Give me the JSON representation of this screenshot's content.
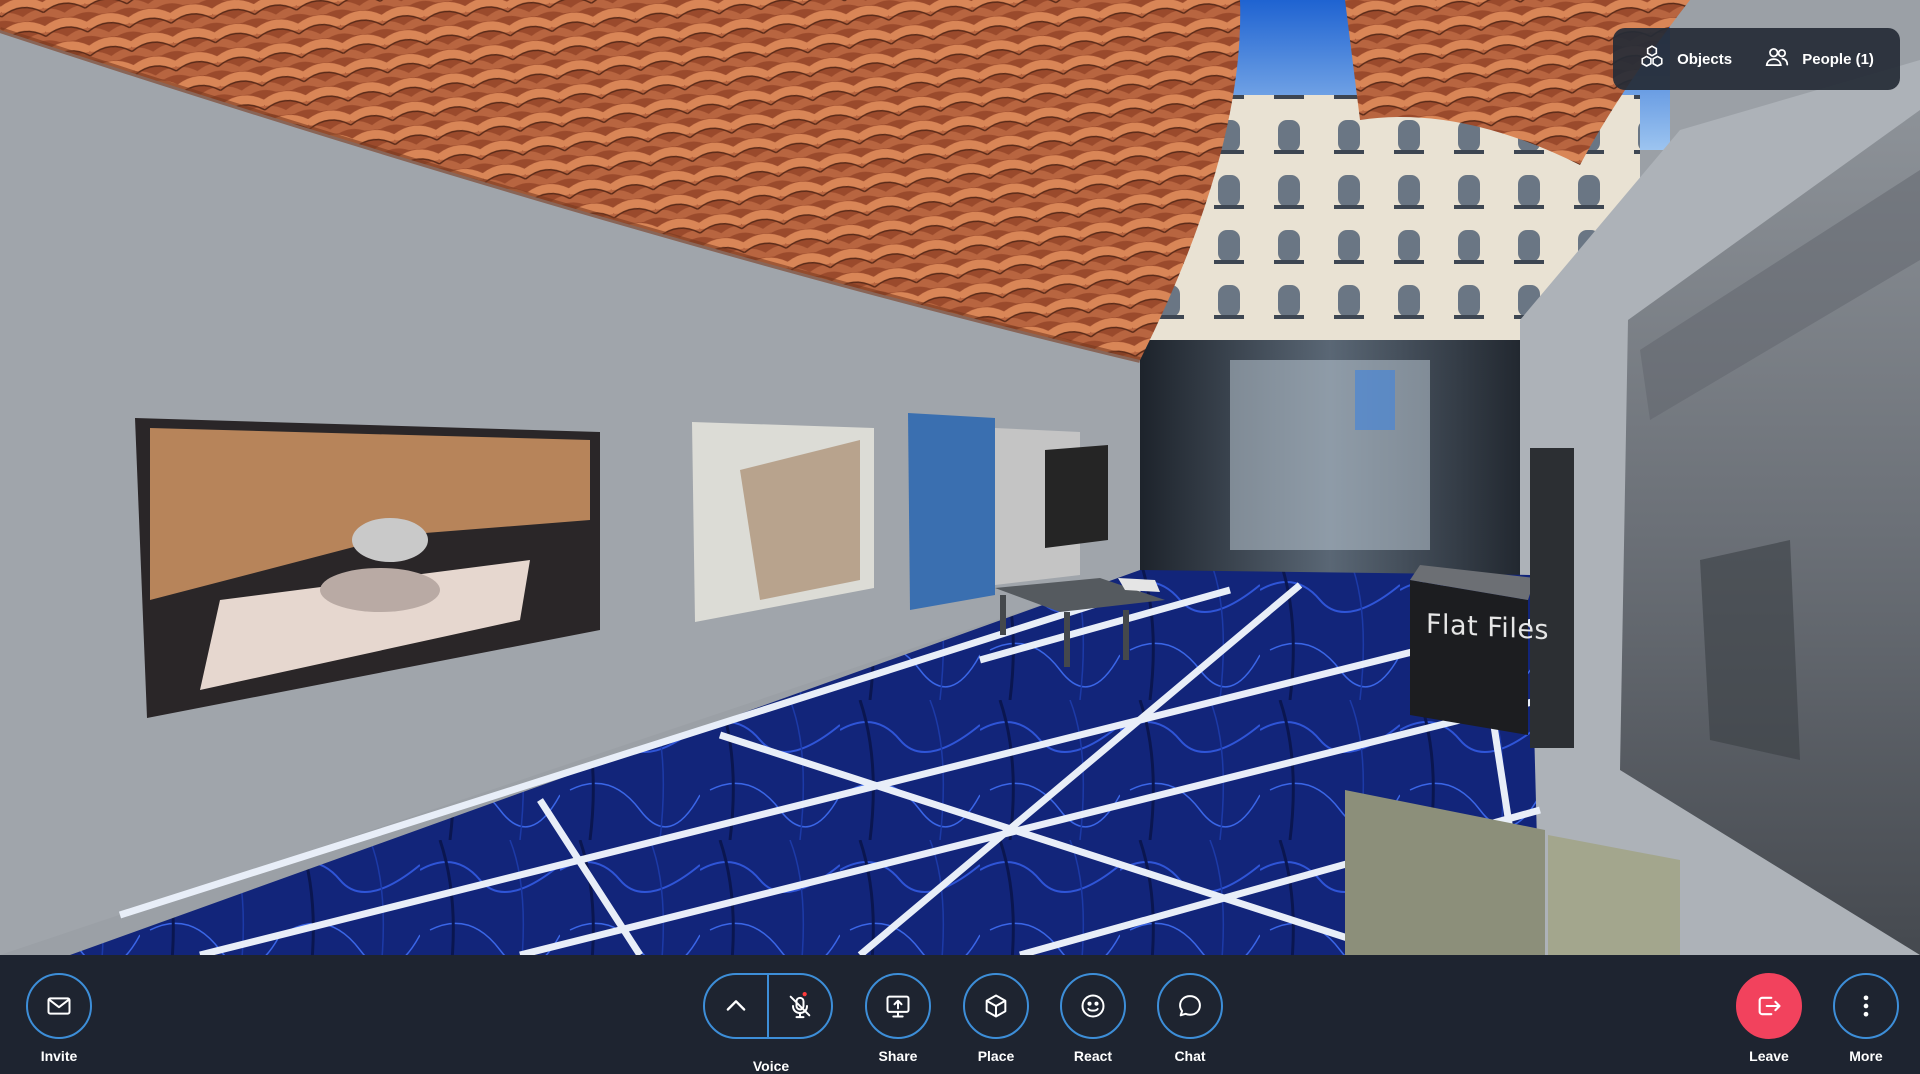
{
  "scene": {
    "wall_sign": "Flat Files"
  },
  "top_panel": {
    "objects_label": "Objects",
    "people_label": "People (1)"
  },
  "toolbar": {
    "invite_label": "Invite",
    "voice_label": "Voice",
    "share_label": "Share",
    "place_label": "Place",
    "react_label": "React",
    "chat_label": "Chat",
    "leave_label": "Leave",
    "more_label": "More",
    "mic_muted": true
  },
  "colors": {
    "toolbar_bg": "#1e2430",
    "accent_blue": "#3d8ed8",
    "leave_red": "#f2425d",
    "mute_dot": "#ff3b3b"
  },
  "icons": {
    "objects": "cubes-icon",
    "people": "people-icon",
    "invite": "envelope-icon",
    "voice_expand": "chevron-up-icon",
    "voice": "mic-off-icon",
    "share": "screen-share-icon",
    "place": "cube-icon",
    "react": "smiley-icon",
    "chat": "chat-bubble-icon",
    "leave": "exit-icon",
    "more": "kebab-icon"
  }
}
